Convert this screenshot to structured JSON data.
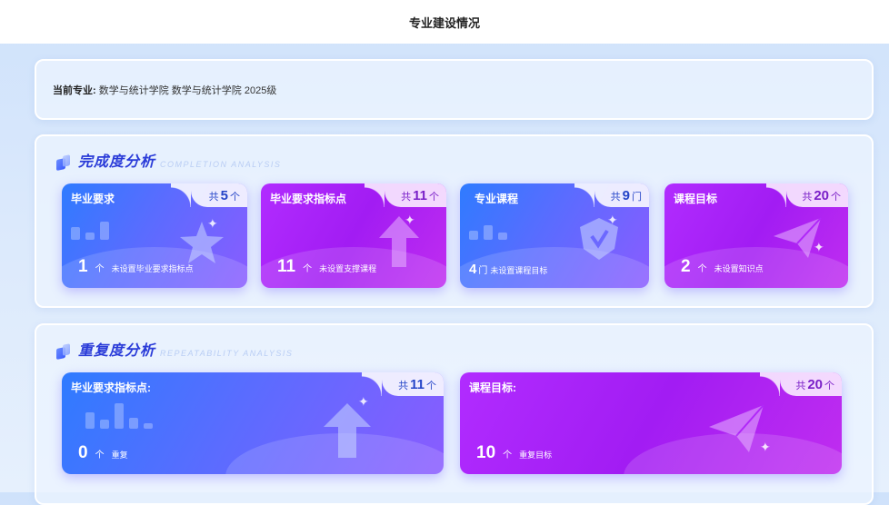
{
  "header": {
    "title": "专业建设情况"
  },
  "major": {
    "label": "当前专业:",
    "value": "数学与统计学院 数学与统计学院 2025级"
  },
  "completion": {
    "title": "完成度分析",
    "subtitle": "COMPLETION ANALYSIS",
    "cards": [
      {
        "title": "毕业要求",
        "total_prefix": "共",
        "total": "5",
        "total_unit": "个",
        "value": "1",
        "value_unit": "个",
        "desc": "未设置毕业要求指标点",
        "color": "#3d74ff",
        "icon": "star-icon"
      },
      {
        "title": "毕业要求指标点",
        "total_prefix": "共",
        "total": "11",
        "total_unit": "个",
        "value": "11",
        "value_unit": "个",
        "desc": "未设置支撑课程",
        "color": "#b12cff",
        "icon": "arrow-up-icon"
      },
      {
        "title": "专业课程",
        "total_prefix": "共",
        "total": "9",
        "total_unit": "门",
        "value": "4",
        "value_unit": "门",
        "desc": "未设置课程目标",
        "color": "#3d74ff",
        "icon": "shield-check-icon"
      },
      {
        "title": "课程目标",
        "total_prefix": "共",
        "total": "20",
        "total_unit": "个",
        "value": "2",
        "value_unit": "个",
        "desc": "未设置知识点",
        "color": "#b12cff",
        "icon": "paper-plane-icon"
      }
    ]
  },
  "repeatability": {
    "title": "重复度分析",
    "subtitle": "REPEATABILITY ANALYSIS",
    "cards": [
      {
        "title": "毕业要求指标点:",
        "total_prefix": "共",
        "total": "11",
        "total_unit": "个",
        "value": "0",
        "value_unit": "个",
        "desc": "重复",
        "color": "#3d74ff",
        "icon": "arrow-up-icon"
      },
      {
        "title": "课程目标:",
        "total_prefix": "共",
        "total": "20",
        "total_unit": "个",
        "value": "10",
        "value_unit": "个",
        "desc": "重复目标",
        "color": "#b12cff",
        "icon": "paper-plane-icon"
      }
    ]
  }
}
